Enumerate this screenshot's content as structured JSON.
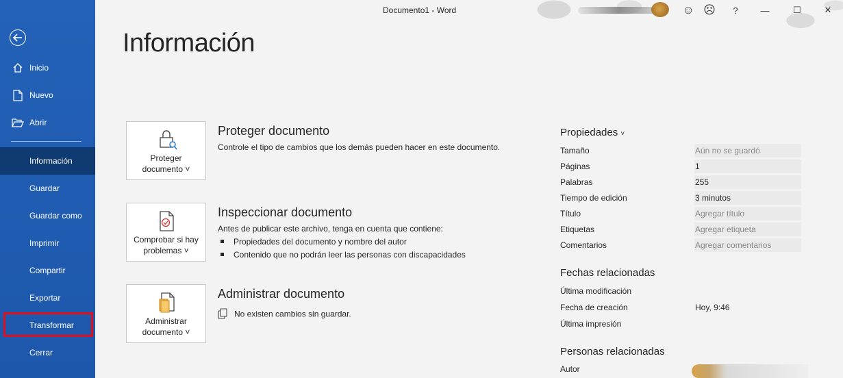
{
  "window": {
    "title": "Documento1  -  Word"
  },
  "sidebar": {
    "items": [
      {
        "label": "Inicio"
      },
      {
        "label": "Nuevo"
      },
      {
        "label": "Abrir"
      },
      {
        "label": "Información"
      },
      {
        "label": "Guardar"
      },
      {
        "label": "Guardar como"
      },
      {
        "label": "Imprimir"
      },
      {
        "label": "Compartir"
      },
      {
        "label": "Exportar"
      },
      {
        "label": "Transformar"
      },
      {
        "label": "Cerrar"
      }
    ]
  },
  "titlebar": {
    "help": "?",
    "minimize": "—",
    "maximize": "☐",
    "close": "✕",
    "smile": "☺",
    "frown": "☹"
  },
  "main": {
    "title": "Información",
    "protect": {
      "button": "Proteger documento",
      "heading": "Proteger documento",
      "desc": "Controle el tipo de cambios que los demás pueden hacer en este documento."
    },
    "inspect": {
      "button": "Comprobar si hay problemas",
      "heading": "Inspeccionar documento",
      "desc": "Antes de publicar este archivo, tenga en cuenta que contiene:",
      "bullets": [
        "Propiedades del documento y nombre del autor",
        "Contenido que no podrán leer las personas con discapacidades"
      ]
    },
    "manage": {
      "button": "Administrar documento",
      "heading": "Administrar documento",
      "desc": "No existen cambios sin guardar."
    }
  },
  "properties": {
    "heading": "Propiedades",
    "rows": [
      {
        "key": "Tamaño",
        "value": "Aún no se guardó"
      },
      {
        "key": "Páginas",
        "value": "1"
      },
      {
        "key": "Palabras",
        "value": "255"
      },
      {
        "key": "Tiempo de edición",
        "value": "3 minutos"
      },
      {
        "key": "Título",
        "value": "Agregar título"
      },
      {
        "key": "Etiquetas",
        "value": "Agregar etiqueta"
      },
      {
        "key": "Comentarios",
        "value": "Agregar comentarios"
      }
    ],
    "dates_heading": "Fechas relacionadas",
    "dates": [
      {
        "key": "Última modificación",
        "value": ""
      },
      {
        "key": "Fecha de creación",
        "value": "Hoy, 9:46"
      },
      {
        "key": "Última impresión",
        "value": ""
      }
    ],
    "people_heading": "Personas relacionadas",
    "people": [
      {
        "key": "Autor"
      }
    ]
  }
}
